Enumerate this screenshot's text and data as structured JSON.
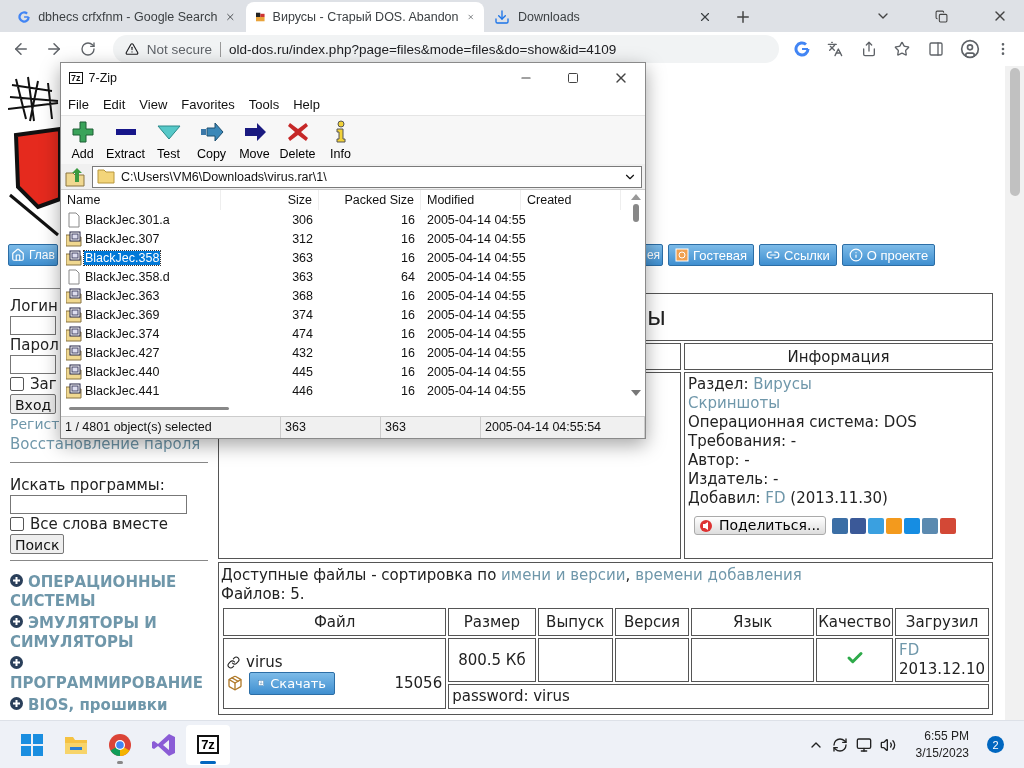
{
  "browser": {
    "tabs": [
      {
        "title": "dbhecs crfxfnm - Google Search",
        "kind": "google",
        "selected": false
      },
      {
        "title": "Вирусы - Старый DOS. Abandon",
        "kind": "site",
        "selected": true
      },
      {
        "title": "Downloads",
        "kind": "download",
        "selected": false
      }
    ],
    "security": "Not secure",
    "url": "old-dos.ru/index.php?page=files&mode=files&do=show&id=4109"
  },
  "archiver": {
    "title": "7-Zip",
    "icon_label": "7z",
    "menu": [
      "File",
      "Edit",
      "View",
      "Favorites",
      "Tools",
      "Help"
    ],
    "toolbar": [
      {
        "label": "Add",
        "kind": "add"
      },
      {
        "label": "Extract",
        "kind": "extract"
      },
      {
        "label": "Test",
        "kind": "test"
      },
      {
        "label": "Copy",
        "kind": "copy"
      },
      {
        "label": "Move",
        "kind": "move"
      },
      {
        "label": "Delete",
        "kind": "delete"
      },
      {
        "label": "Info",
        "kind": "info"
      }
    ],
    "path": "C:\\Users\\VM6\\Downloads\\virus.rar\\1\\",
    "columns": [
      "Name",
      "Size",
      "Packed Size",
      "Modified",
      "Created"
    ],
    "files": [
      {
        "name": "BlackJec.301.a",
        "size": "306",
        "packed": "16",
        "modified": "2005-04-14 04:55",
        "kind": "file",
        "selected": false
      },
      {
        "name": "BlackJec.307",
        "size": "312",
        "packed": "16",
        "modified": "2005-04-14 04:55",
        "kind": "program",
        "selected": false
      },
      {
        "name": "BlackJec.358",
        "size": "363",
        "packed": "16",
        "modified": "2005-04-14 04:55",
        "kind": "program",
        "selected": true
      },
      {
        "name": "BlackJec.358.d",
        "size": "363",
        "packed": "64",
        "modified": "2005-04-14 04:55",
        "kind": "file",
        "selected": false
      },
      {
        "name": "BlackJec.363",
        "size": "368",
        "packed": "16",
        "modified": "2005-04-14 04:55",
        "kind": "program",
        "selected": false
      },
      {
        "name": "BlackJec.369",
        "size": "374",
        "packed": "16",
        "modified": "2005-04-14 04:55",
        "kind": "program",
        "selected": false
      },
      {
        "name": "BlackJec.374",
        "size": "474",
        "packed": "16",
        "modified": "2005-04-14 04:55",
        "kind": "program",
        "selected": false
      },
      {
        "name": "BlackJec.427",
        "size": "432",
        "packed": "16",
        "modified": "2005-04-14 04:55",
        "kind": "program",
        "selected": false
      },
      {
        "name": "BlackJec.440",
        "size": "445",
        "packed": "16",
        "modified": "2005-04-14 04:55",
        "kind": "program",
        "selected": false
      },
      {
        "name": "BlackJec.441",
        "size": "446",
        "packed": "16",
        "modified": "2005-04-14 04:55",
        "kind": "program",
        "selected": false
      }
    ],
    "status": [
      "1 / 4801 object(s) selected",
      "363",
      "363",
      "2005-04-14 04:55:54"
    ]
  },
  "page": {
    "nav": [
      {
        "label": "Глав",
        "kind": "home"
      },
      {
        "label": "ея",
        "kind": "plain"
      },
      {
        "label": "Гостевая",
        "kind": "guestbook"
      },
      {
        "label": "Ссылки",
        "kind": "links"
      },
      {
        "label": "О проекте",
        "kind": "about"
      }
    ],
    "login": {
      "login_label": "Логин",
      "password_label": "Парол",
      "remember_label": "Заг",
      "remember_checked": false,
      "submit": "Вход",
      "register": "Регист",
      "restore": "Восстановление пароля"
    },
    "search": {
      "label": "Искать программы:",
      "all_words": "Все слова вместе",
      "all_words_checked": false,
      "submit": "Поиск"
    },
    "categories": [
      "ОПЕРАЦИОННЫЕ СИСТЕМЫ",
      "ЭМУЛЯТОРЫ И СИМУЛЯТОРЫ",
      "ПРОГРАММИРОВАНИЕ",
      "BIOS, прошивки"
    ],
    "heading": "ы",
    "info": {
      "title": "Информация",
      "lines": [
        [
          {
            "text": "Раздел: ",
            "link": false
          },
          {
            "text": "Вирусы",
            "link": true
          }
        ],
        [
          {
            "text": "Скриншоты",
            "link": true
          }
        ],
        [
          {
            "text": "Операционная система: DOS",
            "link": false
          }
        ],
        [
          {
            "text": "Требования: -",
            "link": false
          }
        ],
        [
          {
            "text": "Автор: -",
            "link": false
          }
        ],
        [
          {
            "text": "Издатель: -",
            "link": false
          }
        ],
        [
          {
            "text": "Добавил: ",
            "link": false
          },
          {
            "text": "FD",
            "link": true
          },
          {
            "text": " (2013.11.30)",
            "link": false
          }
        ]
      ],
      "share": "Поделиться..."
    },
    "files": {
      "sort": [
        {
          "text": "Доступные файлы - сортировка по ",
          "link": false
        },
        {
          "text": "имени и версии",
          "link": true
        },
        {
          "text": ", ",
          "link": false
        },
        {
          "text": "времени добавления",
          "link": true
        }
      ],
      "count": "Файлов: 5.",
      "columns": [
        "Файл",
        "Размер",
        "Выпуск",
        "Версия",
        "Язык",
        "Качество",
        "Загрузил"
      ],
      "rows": [
        {
          "name": "virus",
          "download": "Скачать",
          "downloads": "15056",
          "size": "800.5 Кб",
          "quality_ok": true,
          "uploader": "FD",
          "date": "2013.12.10",
          "note": "password: virus"
        }
      ]
    }
  },
  "taskbar": {
    "apps": [
      {
        "kind": "start",
        "running": false,
        "selected": false
      },
      {
        "kind": "folder",
        "running": false,
        "selected": false
      },
      {
        "kind": "chrome",
        "running": true,
        "selected": false
      },
      {
        "kind": "studio",
        "running": false,
        "selected": false
      },
      {
        "kind": "archiver",
        "label": "7z",
        "running": true,
        "selected": true
      }
    ],
    "time": "6:55 PM",
    "date": "3/15/2023",
    "notifications": "2"
  }
}
